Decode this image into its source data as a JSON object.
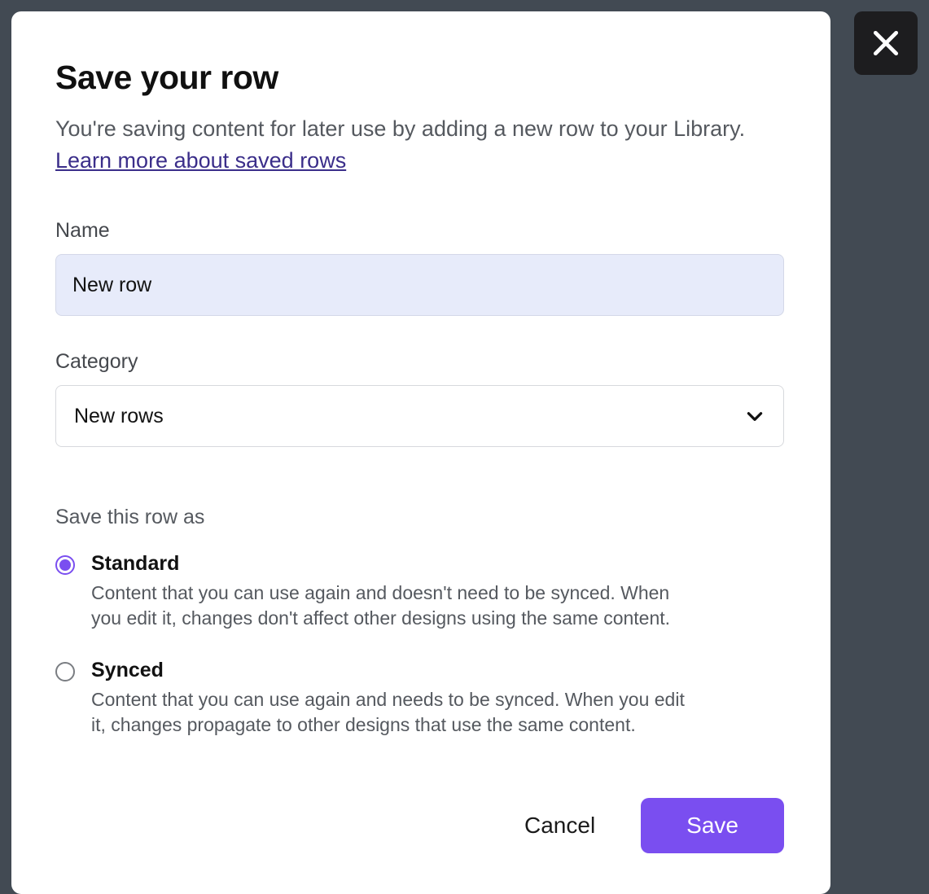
{
  "modal": {
    "title": "Save your row",
    "subtitle_prefix": "You're saving content for later use by adding a new row to your Library. ",
    "learn_more": "Learn more about saved rows"
  },
  "form": {
    "name_label": "Name",
    "name_value": "New row",
    "category_label": "Category",
    "category_value": "New rows"
  },
  "save_as": {
    "section_label": "Save this row as",
    "options": [
      {
        "title": "Standard",
        "desc": "Content that you can use again and doesn't need to be synced. When you edit it, changes don't affect other designs using the same content.",
        "checked": true
      },
      {
        "title": "Synced",
        "desc": "Content that you can use again and needs to be synced. When you edit it, changes propagate to other designs that use the same content.",
        "checked": false
      }
    ]
  },
  "footer": {
    "cancel": "Cancel",
    "save": "Save"
  }
}
